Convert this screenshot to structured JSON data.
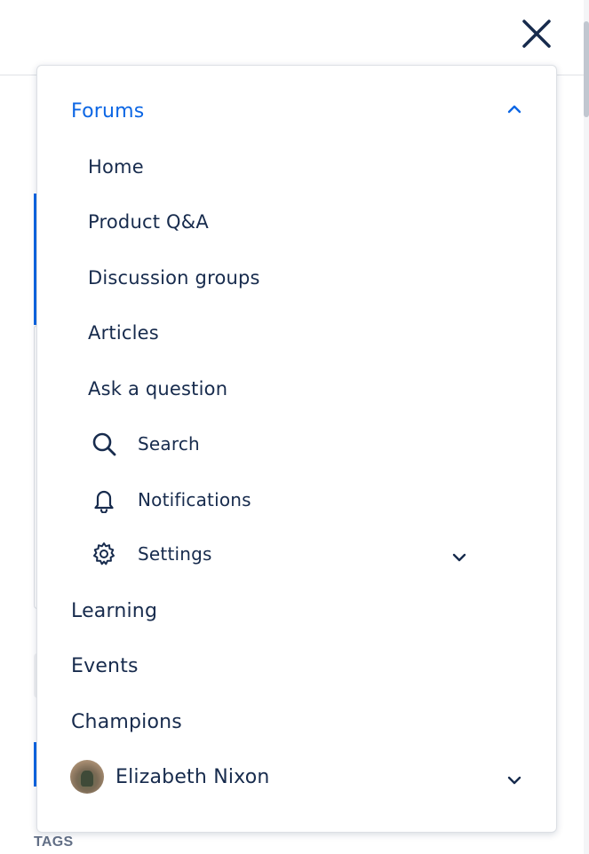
{
  "header": {
    "close_icon": "close-icon"
  },
  "background": {
    "tags_label": "TAGS"
  },
  "menu": {
    "forums": {
      "label": "Forums",
      "expanded": true,
      "chevron_icon": "chevron-up-icon"
    },
    "forum_items": [
      {
        "label": "Home"
      },
      {
        "label": "Product Q&A"
      },
      {
        "label": "Discussion groups"
      },
      {
        "label": "Articles"
      },
      {
        "label": "Ask a question"
      }
    ],
    "forum_tools": [
      {
        "label": "Search",
        "icon": "search-icon"
      },
      {
        "label": "Notifications",
        "icon": "bell-icon"
      },
      {
        "label": "Settings",
        "icon": "gear-icon",
        "chevron_icon": "chevron-down-icon"
      }
    ],
    "sections": [
      {
        "label": "Learning"
      },
      {
        "label": "Events"
      },
      {
        "label": "Champions"
      }
    ],
    "user": {
      "name": "Elizabeth Nixon",
      "avatar": "avatar",
      "chevron_icon": "chevron-down-icon"
    }
  },
  "colors": {
    "accent": "#0c66e4",
    "text": "#172b4d",
    "border": "#dcdfe4"
  }
}
